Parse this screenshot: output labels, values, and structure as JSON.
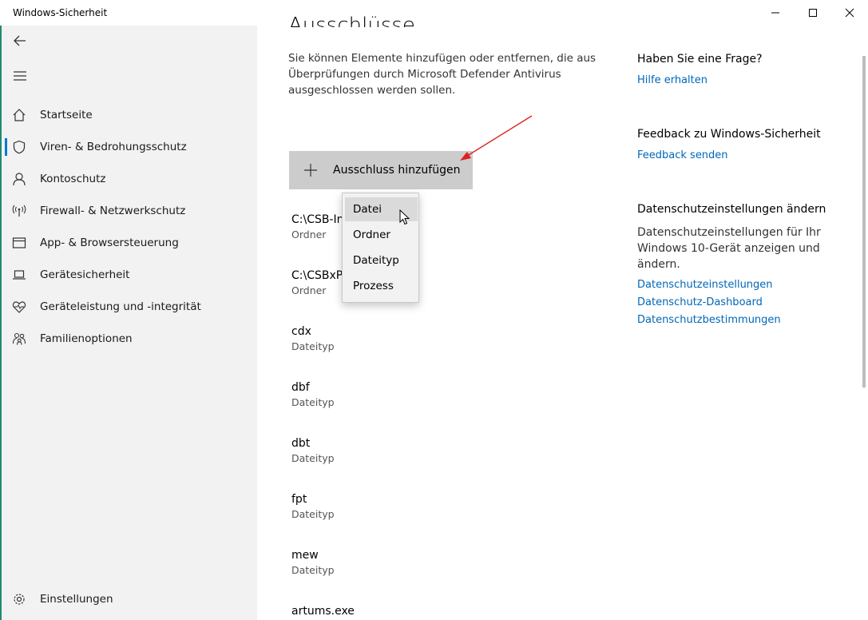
{
  "window": {
    "title": "Windows-Sicherheit"
  },
  "sidebar": {
    "items": [
      {
        "label": "Startseite",
        "icon": "home-icon"
      },
      {
        "label": "Viren- & Bedrohungsschutz",
        "icon": "shield-icon"
      },
      {
        "label": "Kontoschutz",
        "icon": "person-icon"
      },
      {
        "label": "Firewall- & Netzwerkschutz",
        "icon": "antenna-icon"
      },
      {
        "label": "App- & Browsersteuerung",
        "icon": "browser-window-icon"
      },
      {
        "label": "Gerätesicherheit",
        "icon": "laptop-icon"
      },
      {
        "label": "Geräteleistung und -integrität",
        "icon": "heart-pulse-icon"
      },
      {
        "label": "Familienoptionen",
        "icon": "family-icon"
      }
    ],
    "settings": {
      "label": "Einstellungen",
      "icon": "gear-icon"
    }
  },
  "main": {
    "title": "Ausschlüsse",
    "description": "Sie können Elemente hinzufügen oder entfernen, die aus Überprüfungen durch Microsoft Defender Antivirus ausgeschlossen werden sollen.",
    "add_button": "Ausschluss hinzufügen",
    "dropdown": [
      "Datei",
      "Ordner",
      "Dateityp",
      "Prozess"
    ],
    "exclusions": [
      {
        "name": "C:\\CSB-In",
        "type": "Ordner"
      },
      {
        "name": "C:\\CSBxPo",
        "type": "Ordner"
      },
      {
        "name": "cdx",
        "type": "Dateityp"
      },
      {
        "name": "dbf",
        "type": "Dateityp"
      },
      {
        "name": "dbt",
        "type": "Dateityp"
      },
      {
        "name": "fpt",
        "type": "Dateityp"
      },
      {
        "name": "mew",
        "type": "Dateityp"
      },
      {
        "name": "artums.exe",
        "type": ""
      }
    ]
  },
  "right": {
    "question_heading": "Haben Sie eine Frage?",
    "help_link": "Hilfe erhalten",
    "feedback_heading": "Feedback zu Windows-Sicherheit",
    "feedback_link": "Feedback senden",
    "privacy_heading": "Datenschutzeinstellungen ändern",
    "privacy_text": "Datenschutzeinstellungen für Ihr Windows 10-Gerät anzeigen und ändern.",
    "privacy_links": [
      "Datenschutzeinstellungen",
      "Datenschutz-Dashboard",
      "Datenschutzbestimmungen"
    ]
  },
  "colors": {
    "accent": "#0078d4",
    "link": "#0067b8",
    "annotation_arrow": "#e02020"
  }
}
